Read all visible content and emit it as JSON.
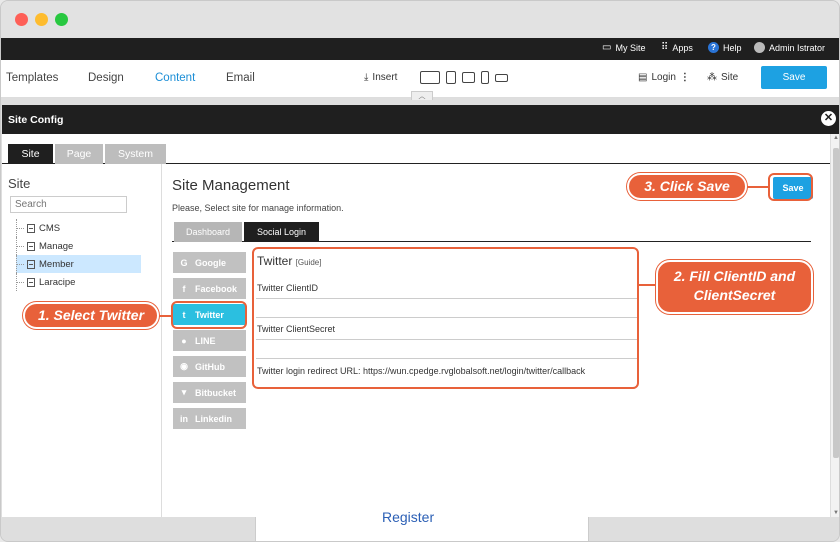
{
  "topbar": {
    "my_site": "My Site",
    "apps": "Apps",
    "help": "Help",
    "user": "Admin Istrator"
  },
  "editor": {
    "nav": [
      "Templates",
      "Design",
      "Content",
      "Email"
    ],
    "active_nav": "Content",
    "insert": "Insert",
    "login": "Login",
    "site": "Site",
    "save": "Save"
  },
  "modal": {
    "title": "Site Config",
    "tabs": [
      "Site",
      "Page",
      "System"
    ],
    "active_tab": "Site"
  },
  "sidebar": {
    "title": "Site",
    "search_placeholder": "Search",
    "items": [
      "CMS",
      "Manage",
      "Member",
      "Laracipe"
    ],
    "selected": "Member"
  },
  "main": {
    "title": "Site Management",
    "description": "Please, Select site for manage information.",
    "save": "Save",
    "subtabs": [
      "Dashboard",
      "Social Login"
    ],
    "active_subtab": "Social Login",
    "providers": [
      {
        "label": "Google",
        "icon": "G"
      },
      {
        "label": "Facebook",
        "icon": "f"
      },
      {
        "label": "Twitter",
        "icon": "t"
      },
      {
        "label": "LINE",
        "icon": "●"
      },
      {
        "label": "GitHub",
        "icon": "◉"
      },
      {
        "label": "Bitbucket",
        "icon": "▾"
      },
      {
        "label": "Linkedin",
        "icon": "in"
      }
    ],
    "active_provider": "Twitter",
    "panel": {
      "title": "Twitter",
      "guide": "[Guide]",
      "client_id_label": "Twitter ClientID",
      "client_id_value": "",
      "client_secret_label": "Twitter ClientSecret",
      "client_secret_value": "",
      "redirect": "Twitter login redirect URL: https://wun.cpedge.rvglobalsoft.net/login/twitter/callback"
    }
  },
  "callouts": {
    "step1": "1. Select Twitter",
    "step2_line1": "2. Fill ClientID and",
    "step2_line2": "ClientSecret",
    "step3": "3. Click Save",
    "accent": "#e8613a"
  },
  "bottom": {
    "link": "Register"
  }
}
